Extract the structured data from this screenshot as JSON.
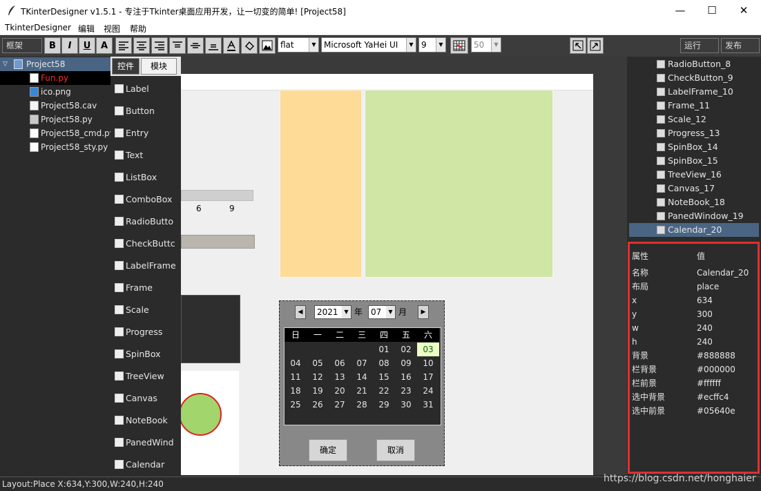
{
  "window": {
    "title": "TKinterDesigner v1.5.1 - 专注于Tkinter桌面应用开发，让一切变的简单!   [Project58]",
    "min_glyph": "—",
    "max_glyph": "☐",
    "close_glyph": "✕"
  },
  "menu": {
    "items": [
      "TkinterDesigner",
      "编辑",
      "视图",
      "帮助"
    ]
  },
  "toolbar": {
    "frame_label": "框架",
    "bold": "B",
    "italic": "I",
    "underline": "U",
    "font_color": "A",
    "relief_value": "flat",
    "font_value": "Microsoft YaHei UI",
    "size_value": "9",
    "grid_value": "50",
    "run_label": "运行",
    "publish_label": "发布"
  },
  "tree": {
    "root": "Project58",
    "files": [
      {
        "name": "Fun.py",
        "icon": "python-file-icon"
      },
      {
        "name": "ico.png",
        "icon": "image-file-icon"
      },
      {
        "name": "Project58.cav",
        "icon": "document-icon"
      },
      {
        "name": "Project58.py",
        "icon": "python-window-icon"
      },
      {
        "name": "Project58_cmd.py",
        "icon": "python-file-icon"
      },
      {
        "name": "Project58_sty.py",
        "icon": "python-file-icon"
      }
    ]
  },
  "palette": {
    "tabs": [
      "控件",
      "模块"
    ],
    "items": [
      {
        "label": "Label",
        "icon": "label-icon"
      },
      {
        "label": "Button",
        "icon": "button-icon"
      },
      {
        "label": "Entry",
        "icon": "entry-icon"
      },
      {
        "label": "Text",
        "icon": "text-icon"
      },
      {
        "label": "ListBox",
        "icon": "listbox-icon"
      },
      {
        "label": "ComboBox",
        "icon": "combobox-icon"
      },
      {
        "label": "RadioButto",
        "icon": "radiobutton-icon"
      },
      {
        "label": "CheckButtc",
        "icon": "checkbutton-icon"
      },
      {
        "label": "LabelFrame",
        "icon": "labelframe-icon"
      },
      {
        "label": "Frame",
        "icon": "frame-icon"
      },
      {
        "label": "Scale",
        "icon": "scale-icon"
      },
      {
        "label": "Progress",
        "icon": "progress-icon"
      },
      {
        "label": "SpinBox",
        "icon": "spinbox-icon"
      },
      {
        "label": "TreeView",
        "icon": "treeview-icon"
      },
      {
        "label": "Canvas",
        "icon": "canvas-icon"
      },
      {
        "label": "NoteBook",
        "icon": "notebook-icon"
      },
      {
        "label": "PanedWind",
        "icon": "panedwindow-icon"
      },
      {
        "label": "Calendar",
        "icon": "calendar-icon"
      }
    ]
  },
  "canvas": {
    "scale_labels": [
      "6",
      "9"
    ],
    "colors": {
      "orange_panel": "#ffdb98",
      "green_panel": "#d0e6a5",
      "circle_fill": "#a2d56b",
      "circle_stroke": "#e02020"
    }
  },
  "calendar": {
    "year": "2021",
    "year_unit": "年",
    "month": "07",
    "month_unit": "月",
    "weekdays": [
      "日",
      "一",
      "二",
      "三",
      "四",
      "五",
      "六"
    ],
    "rows": [
      [
        "",
        "",
        "",
        "",
        "01",
        "02",
        "03"
      ],
      [
        "04",
        "05",
        "06",
        "07",
        "08",
        "09",
        "10"
      ],
      [
        "11",
        "12",
        "13",
        "14",
        "15",
        "16",
        "17"
      ],
      [
        "18",
        "19",
        "20",
        "21",
        "22",
        "23",
        "24"
      ],
      [
        "25",
        "26",
        "27",
        "28",
        "29",
        "30",
        "31"
      ]
    ],
    "selected": "03",
    "ok_label": "确定",
    "cancel_label": "取消",
    "colors": {
      "bg": "#888888",
      "bar_bg": "#000000",
      "bar_fg": "#ffffff",
      "sel_bg": "#ecffc4",
      "sel_fg": "#05640e"
    }
  },
  "widgets": {
    "items": [
      {
        "label": "RadioButton_8",
        "icon": "radiobutton-icon"
      },
      {
        "label": "CheckButton_9",
        "icon": "checkbutton-icon"
      },
      {
        "label": "LabelFrame_10",
        "icon": "labelframe-icon"
      },
      {
        "label": "Frame_11",
        "icon": "frame-icon"
      },
      {
        "label": "Scale_12",
        "icon": "scale-icon"
      },
      {
        "label": "Progress_13",
        "icon": "progress-icon"
      },
      {
        "label": "SpinBox_14",
        "icon": "spinbox-icon"
      },
      {
        "label": "SpinBox_15",
        "icon": "spinbox-icon"
      },
      {
        "label": "TreeView_16",
        "icon": "treeview-icon"
      },
      {
        "label": "Canvas_17",
        "icon": "canvas-icon"
      },
      {
        "label": "NoteBook_18",
        "icon": "notebook-icon"
      },
      {
        "label": "PanedWindow_19",
        "icon": "panedwindow-icon"
      },
      {
        "label": "Calendar_20",
        "icon": "calendar-icon"
      }
    ],
    "selected": "Calendar_20"
  },
  "properties": {
    "header_key": "属性",
    "header_value": "值",
    "rows": [
      {
        "key": "名称",
        "value": "Calendar_20"
      },
      {
        "key": "布局",
        "value": "place"
      },
      {
        "key": "x",
        "value": "634"
      },
      {
        "key": "y",
        "value": "300"
      },
      {
        "key": "w",
        "value": "240"
      },
      {
        "key": "h",
        "value": "240"
      },
      {
        "key": "背景",
        "value": "#888888"
      },
      {
        "key": "栏背景",
        "value": "#000000"
      },
      {
        "key": "栏前景",
        "value": "#ffffff"
      },
      {
        "key": "选中背景",
        "value": "#ecffc4"
      },
      {
        "key": "选中前景",
        "value": "#05640e"
      }
    ]
  },
  "status": {
    "text": "Layout:Place  X:634,Y:300,W:240,H:240",
    "watermark": "https://blog.csdn.net/honghaier"
  }
}
